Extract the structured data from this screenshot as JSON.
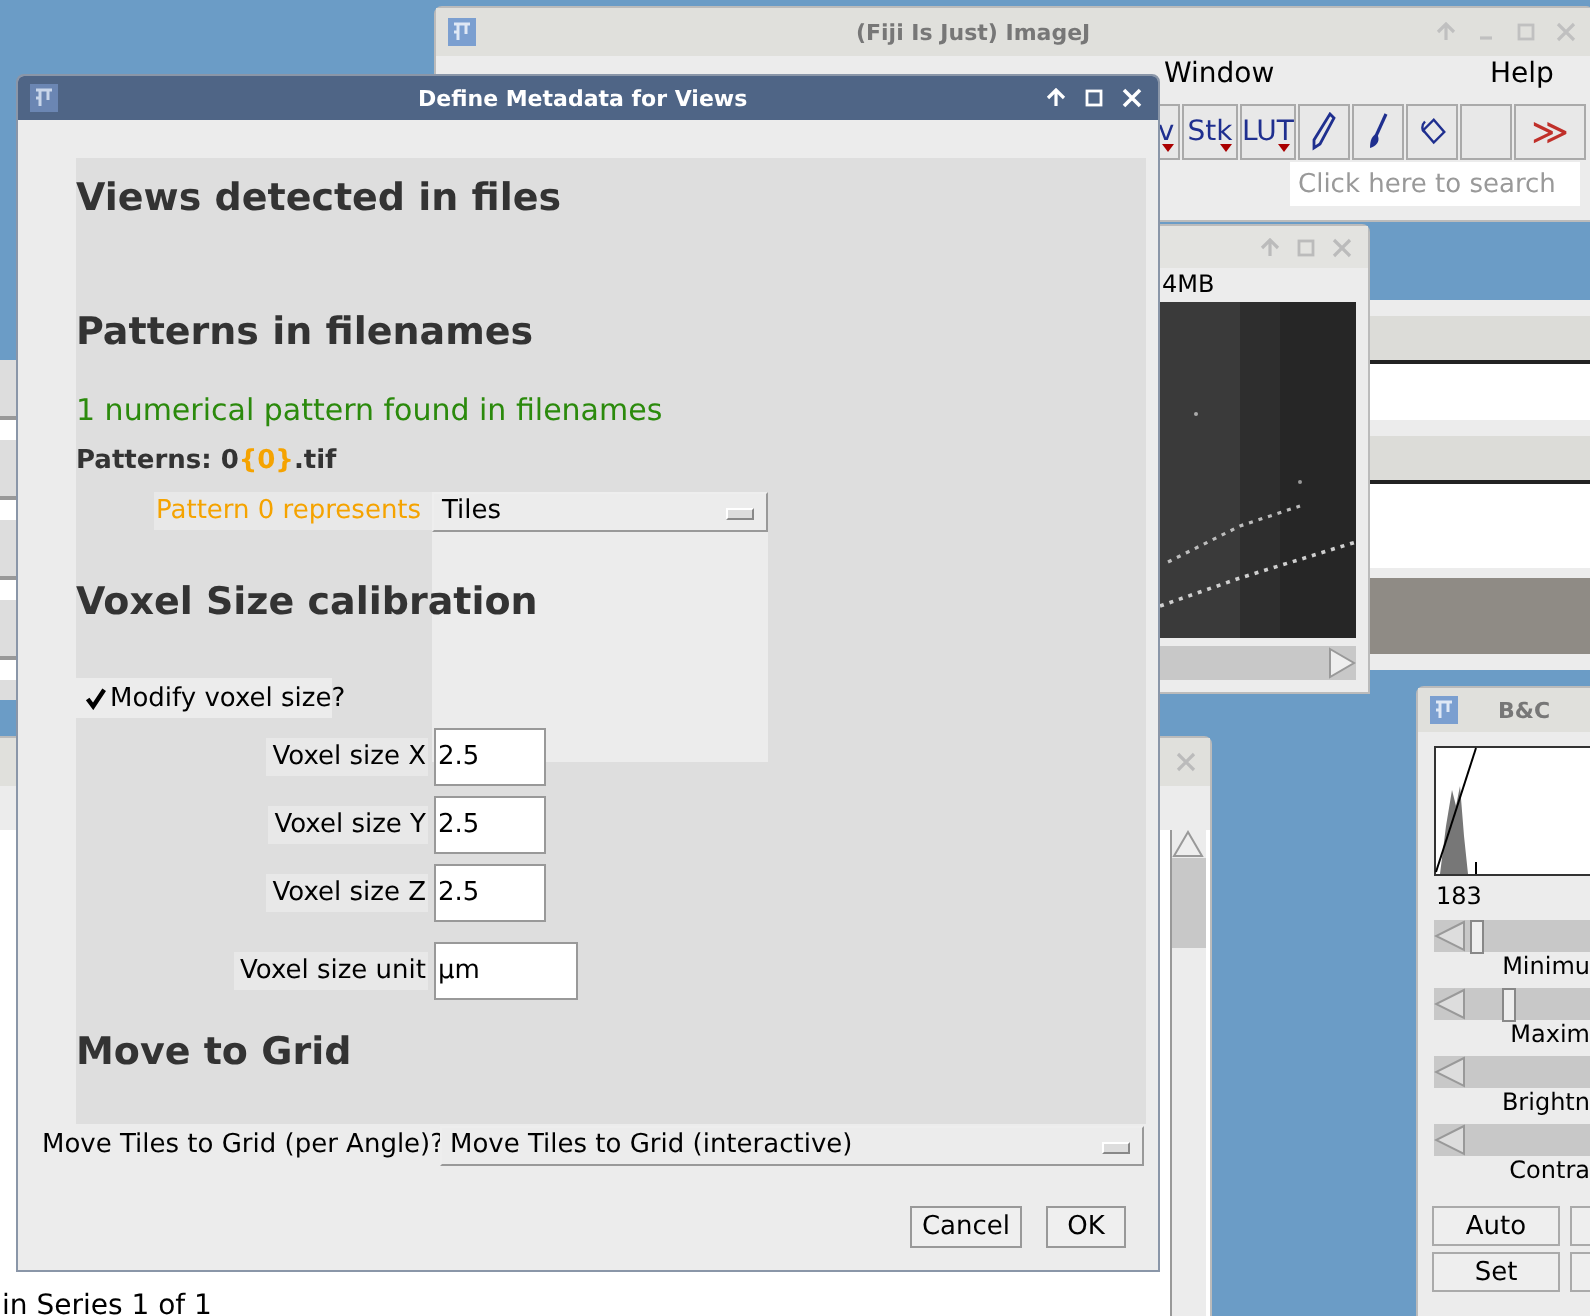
{
  "main_window": {
    "title": "(Fiji Is Just) ImageJ",
    "menu": [
      "Window",
      "Help"
    ],
    "toolbar": [
      {
        "kind": "menu",
        "label": "v"
      },
      {
        "kind": "menu",
        "label": "Stk"
      },
      {
        "kind": "menu",
        "label": "LUT"
      },
      {
        "kind": "pencil"
      },
      {
        "kind": "brush"
      },
      {
        "kind": "bucket"
      },
      {
        "kind": "blank"
      },
      {
        "kind": "more",
        "label": "≫"
      }
    ],
    "search": {
      "placeholder": "Click here to search"
    }
  },
  "image_window": {
    "info": "4MB"
  },
  "log_window": {
    "line": "in Series 1 of 1"
  },
  "bc_window": {
    "title": "B&C",
    "value": "183",
    "sliders": [
      {
        "label": "Minimu",
        "level": 0.09
      },
      {
        "label": "Maxim",
        "level": 0.17
      },
      {
        "label": "Brightn"
      },
      {
        "label": "Contra"
      }
    ],
    "buttons": [
      "Auto",
      "Set"
    ]
  },
  "dialog": {
    "title": "Define Metadata for Views",
    "heading_views": "Views detected in files",
    "heading_patterns": "Patterns in filenames",
    "pattern_status": "1 numerical pattern found in filenames",
    "patterns": {
      "label": "Patterns: ",
      "before": "0",
      "variable": "{0}",
      "after": ".tif"
    },
    "pattern_choice": {
      "label": "Pattern 0 represents",
      "value": "Tiles"
    },
    "heading_voxel": "Voxel Size calibration",
    "modify_voxel": {
      "label": "Modify voxel size?",
      "checked": true
    },
    "voxel_fields": [
      {
        "label": "Voxel size X",
        "value": "2.5"
      },
      {
        "label": "Voxel size Y",
        "value": "2.5"
      },
      {
        "label": "Voxel size Z",
        "value": "2.5"
      },
      {
        "label": "Voxel size unit",
        "value": "µm"
      }
    ],
    "heading_grid": "Move to Grid",
    "grid_choice": {
      "label": "Move Tiles to Grid (per Angle)?",
      "value": "Move Tiles to Grid (interactive)"
    },
    "buttons": [
      "Cancel",
      "OK"
    ]
  }
}
